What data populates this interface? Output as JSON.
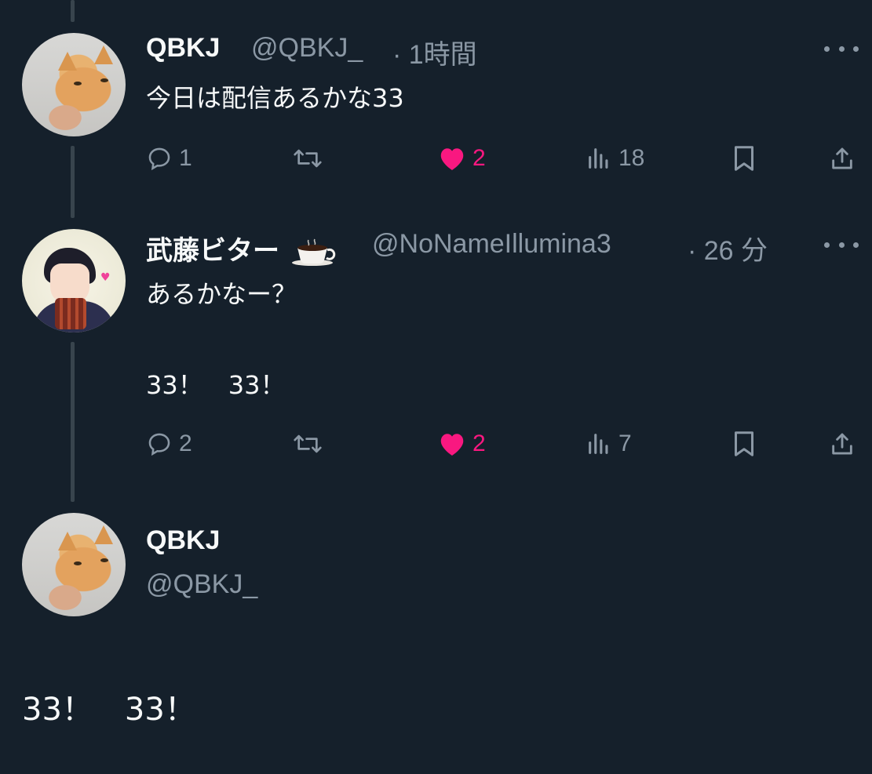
{
  "tweets": [
    {
      "name": "QBKJ",
      "handle": "@QBKJ_",
      "time": "· 1時間",
      "text": "今日は配信あるかな33",
      "stats": {
        "replies": "1",
        "retweets": "",
        "likes": "2",
        "views": "18"
      }
    },
    {
      "name": "武藤ビター",
      "name_emoji": "☕",
      "handle": "@NoNameIllumina3",
      "time": "· 26 分",
      "text_line1": "あるかなー？",
      "text_line2": "33！　33！",
      "stats": {
        "replies": "2",
        "retweets": "",
        "likes": "2",
        "views": "7"
      }
    }
  ],
  "compose": {
    "name": "QBKJ",
    "handle": "@QBKJ_",
    "text": "33！　33！"
  },
  "colors": {
    "background": "#15202b",
    "like_pink": "#f91880",
    "muted": "#8b98a5",
    "thread_line": "#38444d"
  }
}
